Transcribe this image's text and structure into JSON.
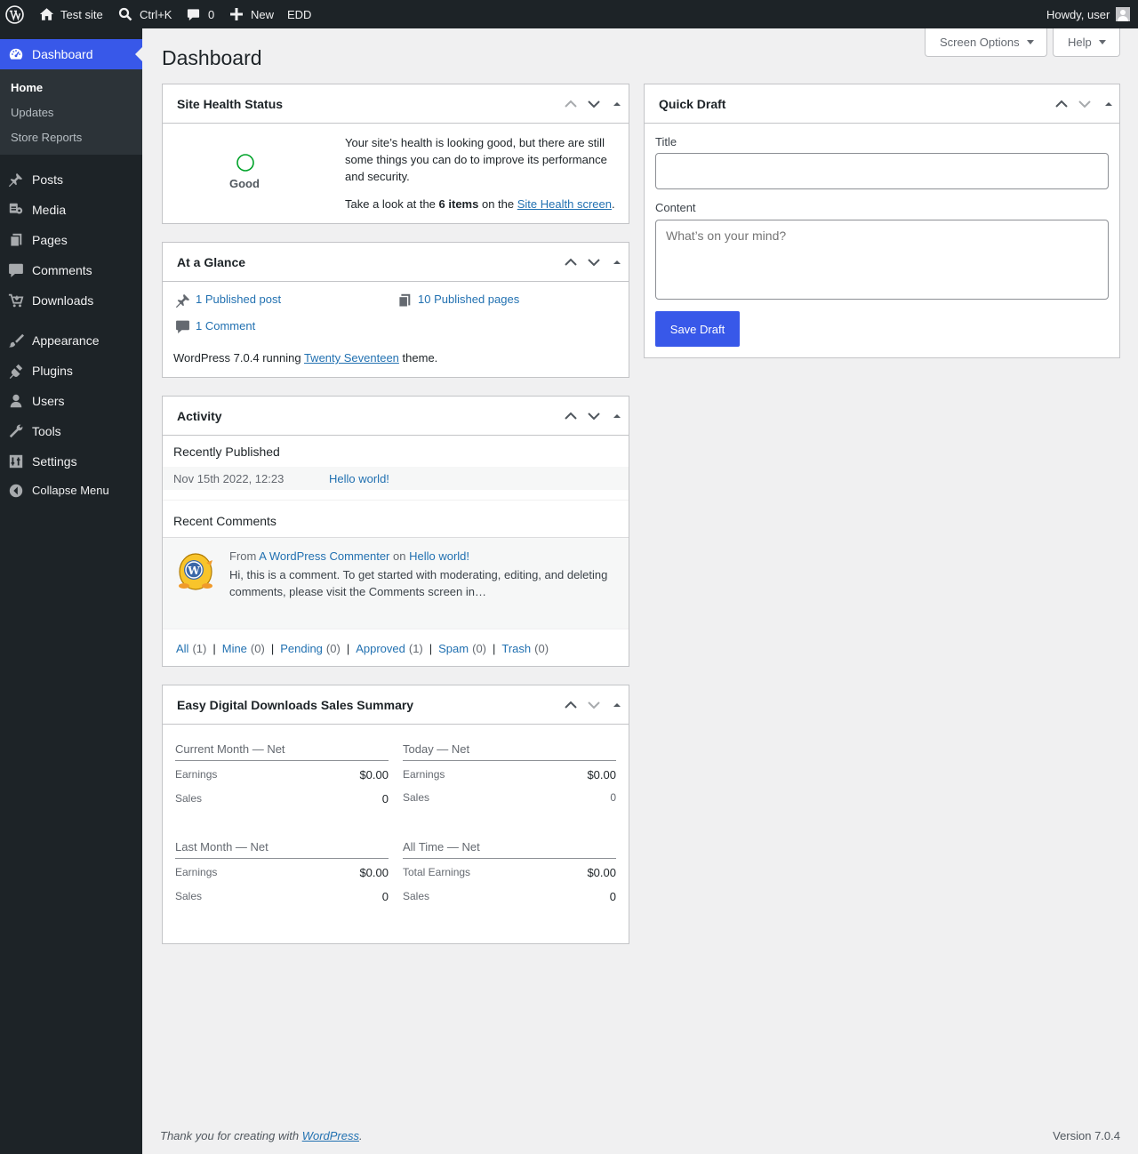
{
  "adminbar": {
    "site_name": "Test site",
    "search_shortcut": "Ctrl+K",
    "comments_count": "0",
    "new_label": "New",
    "edd_label": "EDD",
    "howdy": "Howdy, user"
  },
  "sidebar": {
    "dashboard": "Dashboard",
    "home": "Home",
    "updates": "Updates",
    "store_reports": "Store Reports",
    "posts": "Posts",
    "media": "Media",
    "pages": "Pages",
    "comments": "Comments",
    "downloads": "Downloads",
    "appearance": "Appearance",
    "plugins": "Plugins",
    "users": "Users",
    "tools": "Tools",
    "settings": "Settings",
    "collapse": "Collapse Menu"
  },
  "header": {
    "page_title": "Dashboard",
    "screen_options": "Screen Options",
    "help": "Help"
  },
  "site_health": {
    "title": "Site Health Status",
    "status": "Good",
    "msg": "Your site’s health is looking good, but there are still some things you can do to improve its performance and security.",
    "look_prefix": "Take a look at the",
    "items_count": "6 items",
    "on_the": "on the",
    "screen_link": "Site Health screen",
    "period": "."
  },
  "glance": {
    "title": "At a Glance",
    "posts": "1 Published post",
    "pages": "10 Published pages",
    "comments": "1 Comment",
    "wp_prefix": "WordPress 7.0.4 running",
    "theme": "Twenty Seventeen",
    "wp_suffix": "theme."
  },
  "activity": {
    "title": "Activity",
    "recent_published": "Recently Published",
    "pub_date": "Nov 15th 2022, 12:23",
    "pub_title": "Hello world!",
    "recent_comments": "Recent Comments",
    "from": "From",
    "author": "A WordPress Commenter",
    "on": "on",
    "comment_post": "Hello world!",
    "comment_text": "Hi, this is a comment. To get started with moderating, editing, and deleting comments, please visit the Comments screen in…",
    "filters": [
      {
        "label": "All",
        "count": "(1)"
      },
      {
        "label": "Mine",
        "count": "(0)"
      },
      {
        "label": "Pending",
        "count": "(0)"
      },
      {
        "label": "Approved",
        "count": "(1)"
      },
      {
        "label": "Spam",
        "count": "(0)"
      },
      {
        "label": "Trash",
        "count": "(0)"
      }
    ],
    "separator": "|"
  },
  "edd": {
    "title": "Easy Digital Downloads Sales Summary",
    "current_month": {
      "heading": "Current Month — Net",
      "earnings_label": "Earnings",
      "earnings": "$0.00",
      "sales_label": "Sales",
      "sales": "0"
    },
    "today": {
      "heading": "Today — Net",
      "earnings_label": "Earnings",
      "earnings": "$0.00",
      "sales_label": "Sales",
      "sales": "0"
    },
    "last_month": {
      "heading": "Last Month — Net",
      "earnings_label": "Earnings",
      "earnings": "$0.00",
      "sales_label": "Sales",
      "sales": "0"
    },
    "all_time": {
      "heading": "All Time — Net",
      "earnings_label": "Total Earnings",
      "earnings": "$0.00",
      "sales_label": "Sales",
      "sales": "0"
    }
  },
  "quick_draft": {
    "title": "Quick Draft",
    "title_label": "Title",
    "title_value": "",
    "content_label": "Content",
    "content_placeholder": "What’s on your mind?",
    "save": "Save Draft"
  },
  "footer": {
    "thanks_prefix": "Thank you for creating with",
    "wp_link": "WordPress",
    "period": ".",
    "version": "Version 7.0.4"
  },
  "colors": {
    "accent": "#3858e9",
    "adminbar_bg": "#1d2327",
    "link": "#2271b1",
    "health_good": "#00a32a"
  }
}
